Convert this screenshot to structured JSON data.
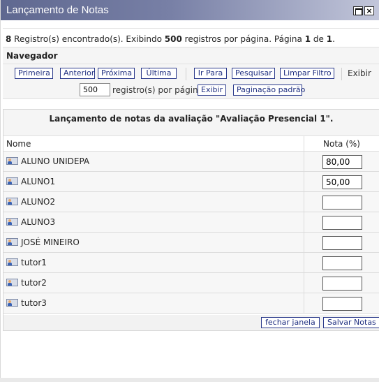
{
  "window": {
    "title": "Lançamento de Notas",
    "maximize_icon": "maximize-icon",
    "close_label": "×"
  },
  "info": {
    "count": "8",
    "found_text": " Registro(s) encontrado(s). Exibindo ",
    "per_page": "500",
    "per_page_text": " registros por página. Página ",
    "page": "1",
    "of_text": " de ",
    "total_pages": "1",
    "end": "."
  },
  "navigator": {
    "title": "Navegador",
    "buttons": {
      "first": "Primeira",
      "previous": "Anterior",
      "next": "Próxima",
      "last": "Última",
      "goto": "Ir Para",
      "search": "Pesquisar",
      "clear_filter": "Limpar Filtro"
    },
    "show_label": "Exibir",
    "per_page_value": "500",
    "per_page_label": "registro(s) por página.",
    "show_button": "Exibir",
    "default_paging_button": "Paginação padrão"
  },
  "grades": {
    "heading": "Lançamento de notas da avaliação \"Avaliação Presencial 1\".",
    "columns": {
      "name": "Nome",
      "grade": "Nota (%)"
    },
    "rows": [
      {
        "name": "ALUNO UNIDEPA",
        "grade": "80,00"
      },
      {
        "name": "ALUNO1",
        "grade": "50,00"
      },
      {
        "name": "ALUNO2",
        "grade": ""
      },
      {
        "name": "ALUNO3",
        "grade": ""
      },
      {
        "name": "JOSÉ MINEIRO",
        "grade": ""
      },
      {
        "name": "tutor1",
        "grade": ""
      },
      {
        "name": "tutor2",
        "grade": ""
      },
      {
        "name": "tutor3",
        "grade": ""
      }
    ],
    "close_button": "fechar janela",
    "save_button": "Salvar Notas"
  },
  "colors": {
    "titlebar_start": "#5f6890",
    "button_border": "#2b3a8c",
    "button_text": "#1f2f80"
  }
}
